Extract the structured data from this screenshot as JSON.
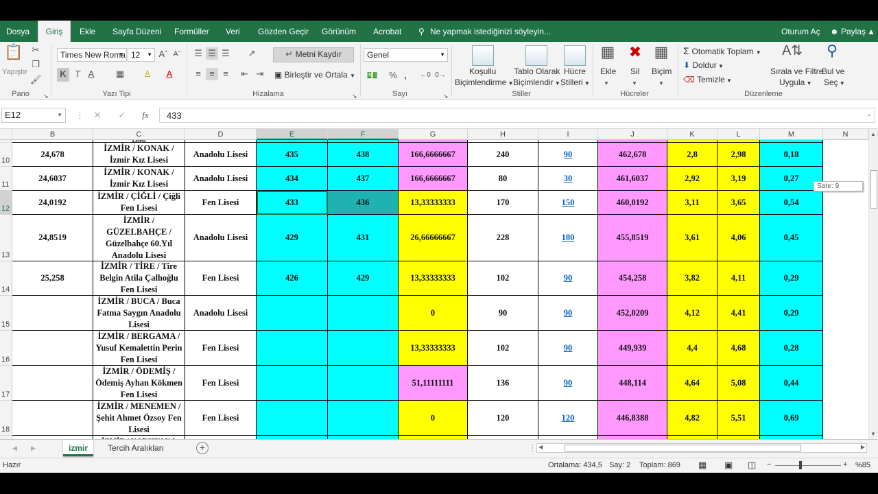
{
  "menu": {
    "items": [
      "Dosya",
      "Giriş",
      "Ekle",
      "Sayfa Düzeni",
      "Formüller",
      "Veri",
      "Gözden Geçir",
      "Görünüm",
      "Acrobat"
    ],
    "tell_me": "Ne yapmak istediğinizi söyleyin...",
    "sign_in": "Oturum Aç",
    "share": "Paylaş"
  },
  "ribbon": {
    "paste": "Yapıştır",
    "clipboard": "Pano",
    "font_name": "Times New Roma",
    "font_size": "12",
    "font_group": "Yazı Tipi",
    "wrap_text": "Metni Kaydır",
    "merge_center": "Birleştir ve Ortala",
    "alignment_group": "Hizalama",
    "number_format": "Genel",
    "number_group": "Sayı",
    "conditional_1": "Koşullu",
    "conditional_2": "Biçimlendirme",
    "table_1": "Tablo Olarak",
    "table_2": "Biçimlendir",
    "cell_styles_1": "Hücre",
    "cell_styles_2": "Stilleri",
    "styles_group": "Stiller",
    "insert": "Ekle",
    "delete": "Sil",
    "format": "Biçim",
    "cells_group": "Hücreler",
    "autosum": "Otomatik Toplam",
    "fill": "Doldur",
    "clear": "Temizle",
    "sort_1": "Sırala ve Filtre",
    "sort_2": "Uygula",
    "find_1": "Bul ve",
    "find_2": "Seç",
    "editing_group": "Düzenleme"
  },
  "formula_bar": {
    "name_box": "E12",
    "fx": "fx",
    "value": "433"
  },
  "columns": [
    "B",
    "C",
    "D",
    "E",
    "F",
    "G",
    "H",
    "I",
    "J",
    "K",
    "L",
    "M",
    "N"
  ],
  "rows": [
    {
      "num": "10",
      "B": "24,678",
      "C": "İZMİR / KONAK / İzmir Kız Lisesi",
      "D": "Anadolu Lisesi",
      "E": "435",
      "F": "438",
      "G": "166,6666667",
      "H": "240",
      "I": "90",
      "J": "462,678",
      "K": "2,8",
      "L": "2,98",
      "M": "0,18"
    },
    {
      "num": "11",
      "B": "24,6037",
      "C": "İZMİR / KONAK / İzmir Kız Lisesi",
      "D": "Anadolu Lisesi",
      "E": "434",
      "F": "437",
      "G": "166,6666667",
      "H": "80",
      "I": "30",
      "J": "461,6037",
      "K": "2,92",
      "L": "3,19",
      "M": "0,27"
    },
    {
      "num": "12",
      "B": "24,0192",
      "C": "İZMİR / ÇİĞLİ / Çiğli Fen Lisesi",
      "D": "Fen Lisesi",
      "E": "433",
      "F": "436",
      "G": "13,33333333",
      "H": "170",
      "I": "150",
      "J": "460,0192",
      "K": "3,11",
      "L": "3,65",
      "M": "0,54"
    },
    {
      "num": "13",
      "B": "24,8519",
      "C": "İZMİR / GÜZELBAHÇE / Güzelbahçe 60.Yıl Anadolu Lisesi",
      "D": "Anadolu Lisesi",
      "E": "429",
      "F": "431",
      "G": "26,66666667",
      "H": "228",
      "I": "180",
      "J": "455,8519",
      "K": "3,61",
      "L": "4,06",
      "M": "0,45"
    },
    {
      "num": "14",
      "B": "25,258",
      "C": "İZMİR / TİRE / Tire Belgin Atila Çalhoğlu Fen Lisesi",
      "D": "Fen Lisesi",
      "E": "426",
      "F": "429",
      "G": "13,33333333",
      "H": "102",
      "I": "90",
      "J": "454,258",
      "K": "3,82",
      "L": "4,11",
      "M": "0,29"
    },
    {
      "num": "15",
      "B": "",
      "C": "İZMİR / BUCA / Buca Fatma Saygın Anadolu Lisesi",
      "D": "Anadolu Lisesi",
      "E": "",
      "F": "",
      "G": "0",
      "H": "90",
      "I": "90",
      "J": "452,0209",
      "K": "4,12",
      "L": "4,41",
      "M": "0,29"
    },
    {
      "num": "16",
      "B": "",
      "C": "İZMİR / BERGAMA / Yusuf Kemalettin Perin Fen Lisesi",
      "D": "Fen Lisesi",
      "E": "",
      "F": "",
      "G": "13,33333333",
      "H": "102",
      "I": "90",
      "J": "449,939",
      "K": "4,4",
      "L": "4,68",
      "M": "0,28"
    },
    {
      "num": "17",
      "B": "",
      "C": "İZMİR / ÖDEMİŞ / Ödemiş Ayhan Kökmen Fen Lisesi",
      "D": "Fen Lisesi",
      "E": "",
      "F": "",
      "G": "51,11111111",
      "H": "136",
      "I": "90",
      "J": "448,114",
      "K": "4,64",
      "L": "5,08",
      "M": "0,44"
    },
    {
      "num": "18",
      "B": "",
      "C": "İZMİR / MENEMEN / Şehit Ahmet Özsoy Fen Lisesi",
      "D": "Fen Lisesi",
      "E": "",
      "F": "",
      "G": "0",
      "H": "120",
      "I": "120",
      "J": "446,8388",
      "K": "4,82",
      "L": "5,51",
      "M": "0,69"
    }
  ],
  "g_colors": [
    "pink",
    "pink",
    "yellow",
    "yellow",
    "yellow",
    "yellow",
    "yellow",
    "pink",
    "yellow"
  ],
  "partial_top_text": "Lisesi",
  "partial_bottom_text": "İZMİR / KARŞIYAKA",
  "tooltip": "Satır: 9",
  "sheets": [
    "izmir",
    "Tercih Aralıkları"
  ],
  "status": {
    "ready": "Hazır",
    "average": "Ortalama: 434,5",
    "count": "Say: 2",
    "sum": "Toplam: 869",
    "zoom": "%85"
  }
}
